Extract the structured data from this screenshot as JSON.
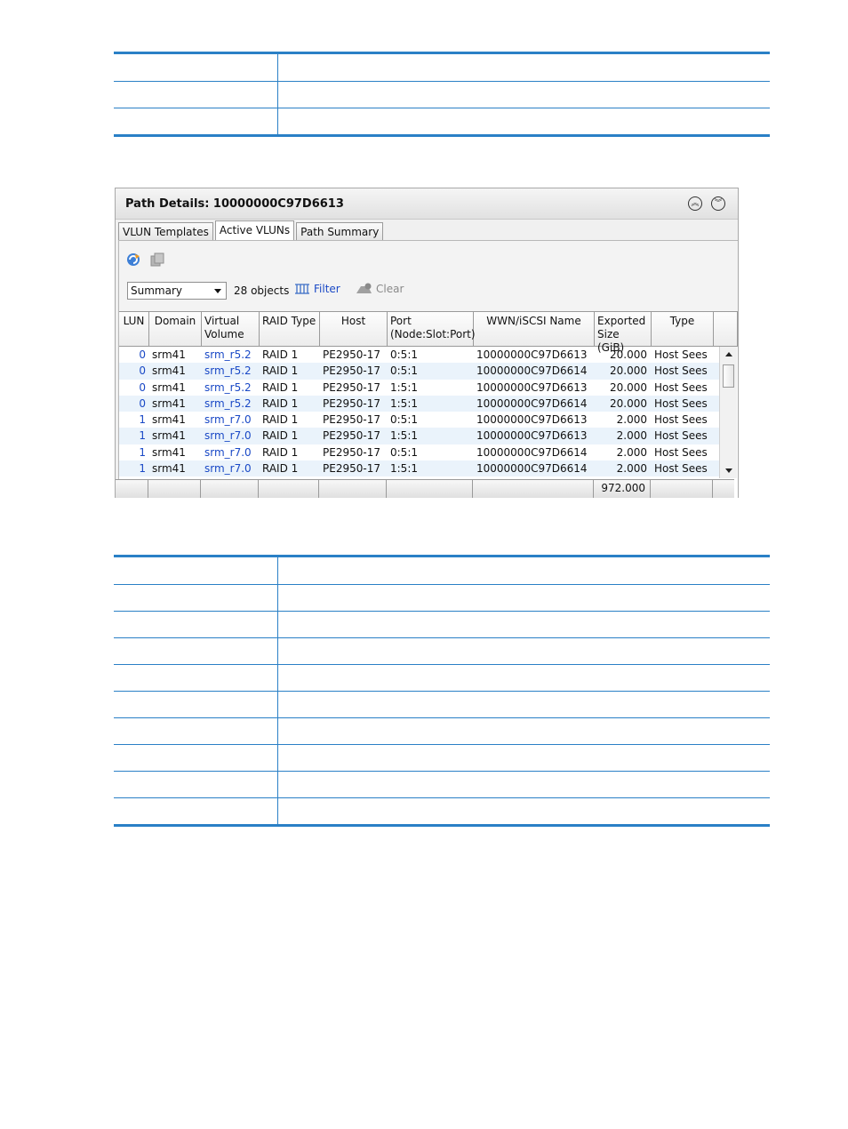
{
  "panel": {
    "title": "Path Details: 10000000C97D6613",
    "tabs": [
      "VLUN Templates",
      "Active VLUNs",
      "Path Summary"
    ],
    "active_tab": "Active VLUNs",
    "view_select": "Summary",
    "object_count": "28 objects",
    "filter_label": "Filter",
    "clear_label": "Clear",
    "columns": [
      "LUN",
      "Domain",
      "Virtual Volume",
      "RAID Type",
      "Host",
      "Port (Node:Slot:Port)",
      "WWN/iSCSI Name",
      "Exported Size (GiB)",
      "Type"
    ],
    "header_lines": [
      [
        "LUN"
      ],
      [
        "Domain"
      ],
      [
        "Virtual",
        "Volume"
      ],
      [
        "RAID Type"
      ],
      [
        "Host"
      ],
      [
        "Port",
        "(Node:Slot:Port)"
      ],
      [
        "WWN/iSCSI Name"
      ],
      [
        "Exported",
        "Size (GiB)"
      ],
      [
        "Type"
      ]
    ],
    "rows": [
      [
        "0",
        "srm41",
        "srm_r5.2",
        "RAID 1",
        "PE2950-17",
        "0:5:1",
        "10000000C97D6613",
        "20.000",
        "Host Sees"
      ],
      [
        "0",
        "srm41",
        "srm_r5.2",
        "RAID 1",
        "PE2950-17",
        "0:5:1",
        "10000000C97D6614",
        "20.000",
        "Host Sees"
      ],
      [
        "0",
        "srm41",
        "srm_r5.2",
        "RAID 1",
        "PE2950-17",
        "1:5:1",
        "10000000C97D6613",
        "20.000",
        "Host Sees"
      ],
      [
        "0",
        "srm41",
        "srm_r5.2",
        "RAID 1",
        "PE2950-17",
        "1:5:1",
        "10000000C97D6614",
        "20.000",
        "Host Sees"
      ],
      [
        "1",
        "srm41",
        "srm_r7.0",
        "RAID 1",
        "PE2950-17",
        "0:5:1",
        "10000000C97D6613",
        "2.000",
        "Host Sees"
      ],
      [
        "1",
        "srm41",
        "srm_r7.0",
        "RAID 1",
        "PE2950-17",
        "1:5:1",
        "10000000C97D6613",
        "2.000",
        "Host Sees"
      ],
      [
        "1",
        "srm41",
        "srm_r7.0",
        "RAID 1",
        "PE2950-17",
        "0:5:1",
        "10000000C97D6614",
        "2.000",
        "Host Sees"
      ],
      [
        "1",
        "srm41",
        "srm_r7.0",
        "RAID 1",
        "PE2950-17",
        "1:5:1",
        "10000000C97D6614",
        "2.000",
        "Host Sees"
      ]
    ],
    "total_exported": "972.000"
  },
  "colors": {
    "table_border": "#2a80c6",
    "link": "#1a49c6",
    "row_alt": "#eaf3fb"
  },
  "icons": [
    "collapse-up-icon",
    "expand-down-icon",
    "refresh-icon",
    "copy-icon",
    "filter-icon",
    "clear-icon"
  ]
}
